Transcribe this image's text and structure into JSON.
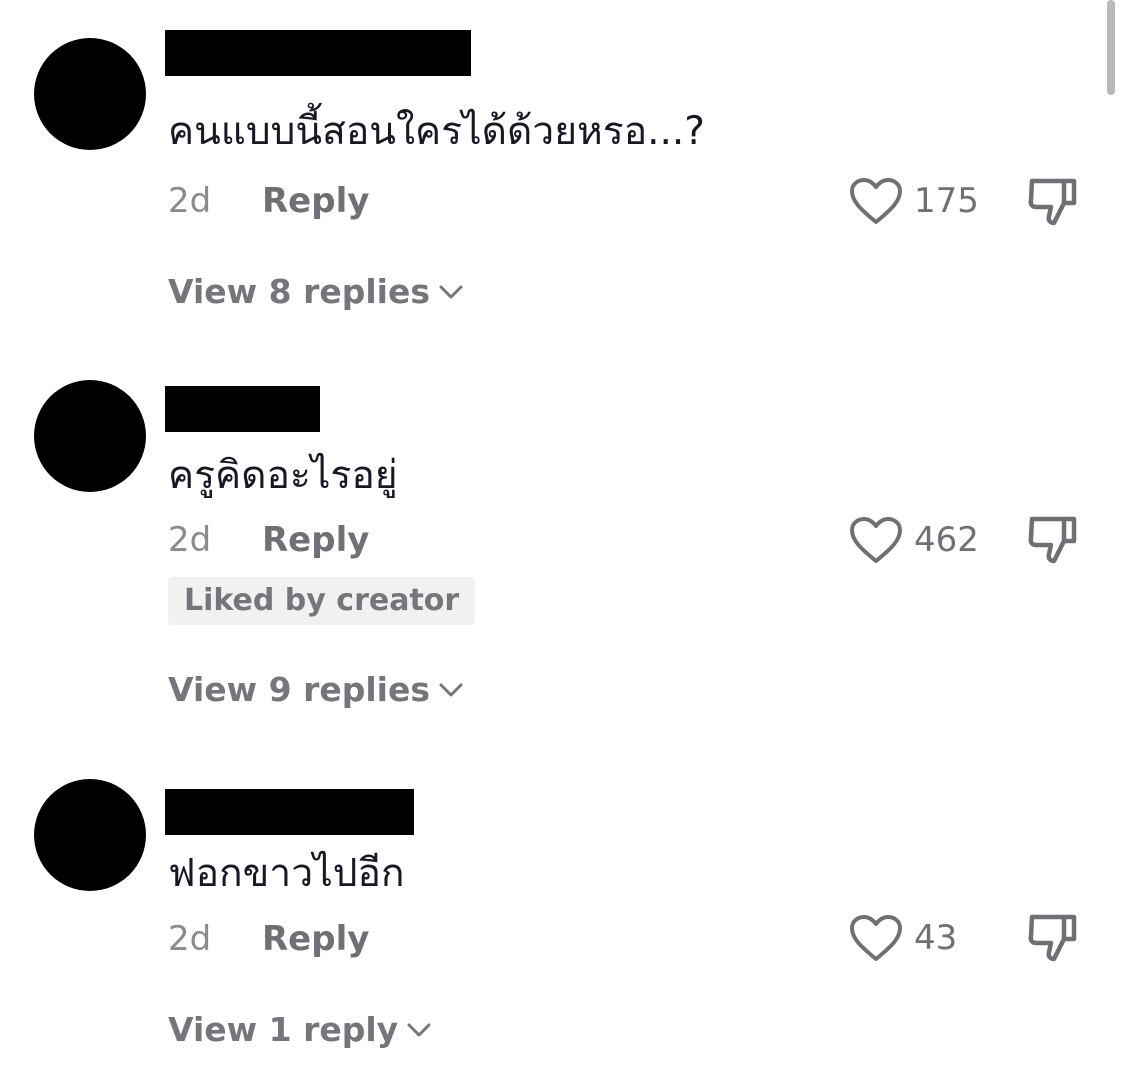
{
  "comments": [
    {
      "text": "คนแบบนี้สอนใครได้ด้วยหรอ...?",
      "time": "2d",
      "reply_label": "Reply",
      "likes": "175",
      "badge": "",
      "view_replies": "View 8 replies"
    },
    {
      "text": "ครูคิดอะไรอยู่",
      "time": "2d",
      "reply_label": "Reply",
      "likes": "462",
      "badge": "Liked by creator",
      "view_replies": "View 9 replies"
    },
    {
      "text": "ฟอกขาวไปอีก",
      "time": "2d",
      "reply_label": "Reply",
      "likes": "43",
      "badge": "",
      "view_replies": "View 1 reply"
    }
  ],
  "icons": {
    "like": "heart-outline",
    "dislike": "thumbs-down-outline",
    "expand": "chevron-down"
  },
  "colors": {
    "text_primary": "#161823",
    "text_secondary": "#75767c",
    "badge_bg": "#f1f1f2",
    "redaction": "#000000"
  }
}
